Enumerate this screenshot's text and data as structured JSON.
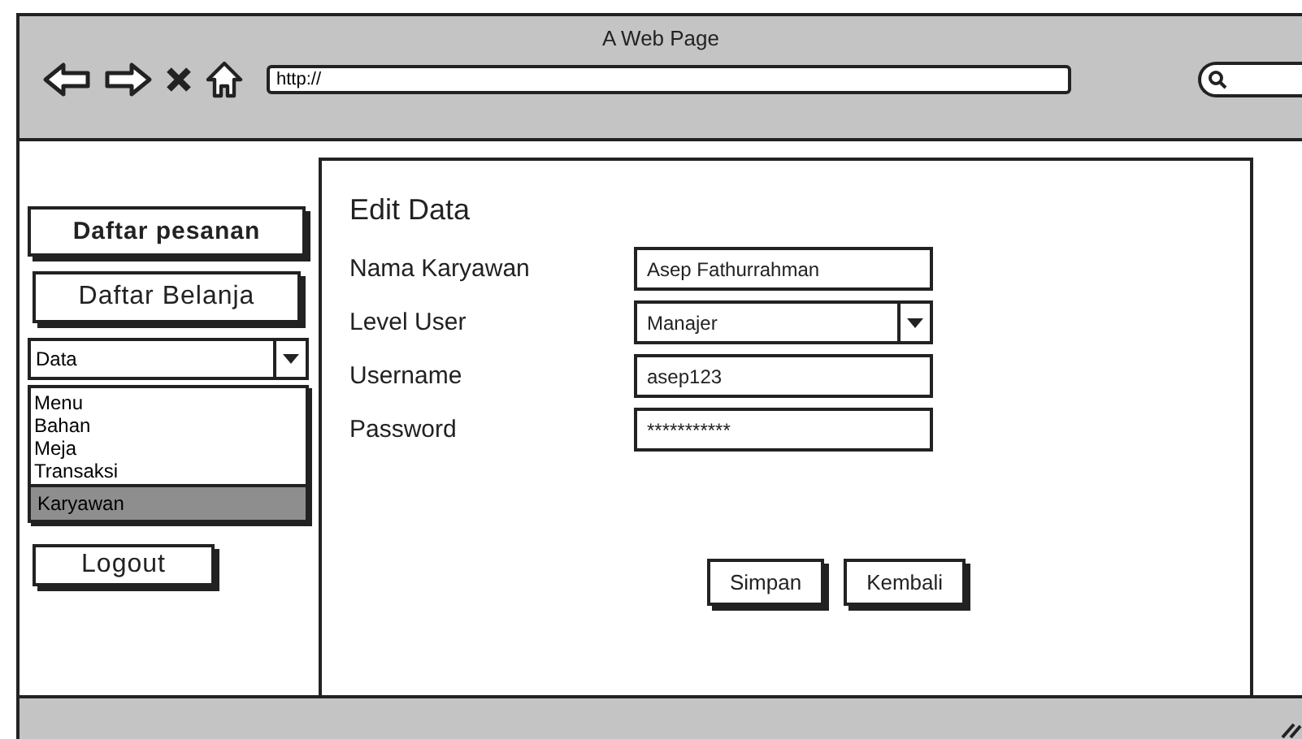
{
  "window": {
    "title": "A Web Page",
    "address": "http://"
  },
  "sidebar": {
    "buttons": [
      "Daftar pesanan",
      "Daftar Belanja"
    ],
    "dropdown": {
      "value": "Data",
      "options": [
        {
          "label": "Menu",
          "selected": false
        },
        {
          "label": "Bahan",
          "selected": false
        },
        {
          "label": "Meja",
          "selected": false
        },
        {
          "label": "Transaksi",
          "selected": false
        },
        {
          "label": "Karyawan",
          "selected": true
        }
      ]
    },
    "logout": "Logout"
  },
  "form": {
    "title": "Edit Data",
    "fields": [
      {
        "label": "Nama Karyawan",
        "kind": "text",
        "value": "Asep Fathurrahman"
      },
      {
        "label": "Level User",
        "kind": "select",
        "value": "Manajer"
      },
      {
        "label": "Username",
        "kind": "text",
        "value": "asep123"
      },
      {
        "label": "Password",
        "kind": "password",
        "value": "***********"
      }
    ],
    "buttons": [
      "Simpan",
      "Kembali"
    ]
  }
}
